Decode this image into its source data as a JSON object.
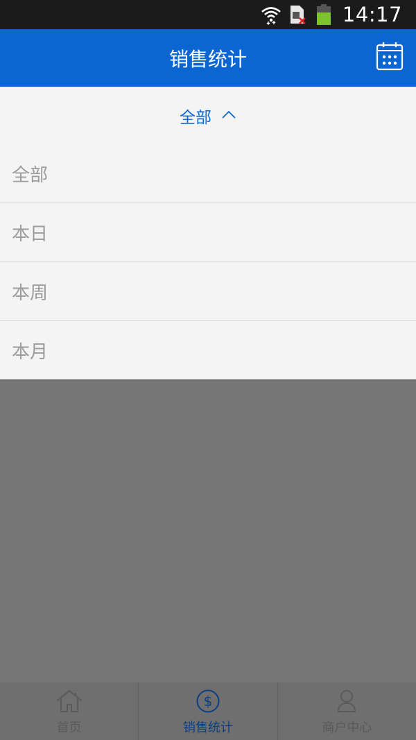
{
  "status_bar": {
    "time": "14:17",
    "icons": [
      "wifi-icon",
      "sim-card-icon",
      "battery-icon"
    ]
  },
  "header": {
    "title": "销售统计",
    "action_icon": "calendar-icon"
  },
  "filter": {
    "selected": "全部",
    "toggle_icon": "chevron-up-icon",
    "options": [
      "全部",
      "本日",
      "本周",
      "本月"
    ]
  },
  "bottom_nav": {
    "items": [
      {
        "label": "首页",
        "icon": "home-icon",
        "active": false
      },
      {
        "label": "销售统计",
        "icon": "dollar-icon",
        "active": true
      },
      {
        "label": "商户中心",
        "icon": "user-icon",
        "active": false
      }
    ]
  },
  "colors": {
    "primary": "#0b66d1",
    "status_bar": "#1b1b1b",
    "panel": "#f4f4f4",
    "overlay": "#767676",
    "battery": "#7dc42c"
  }
}
